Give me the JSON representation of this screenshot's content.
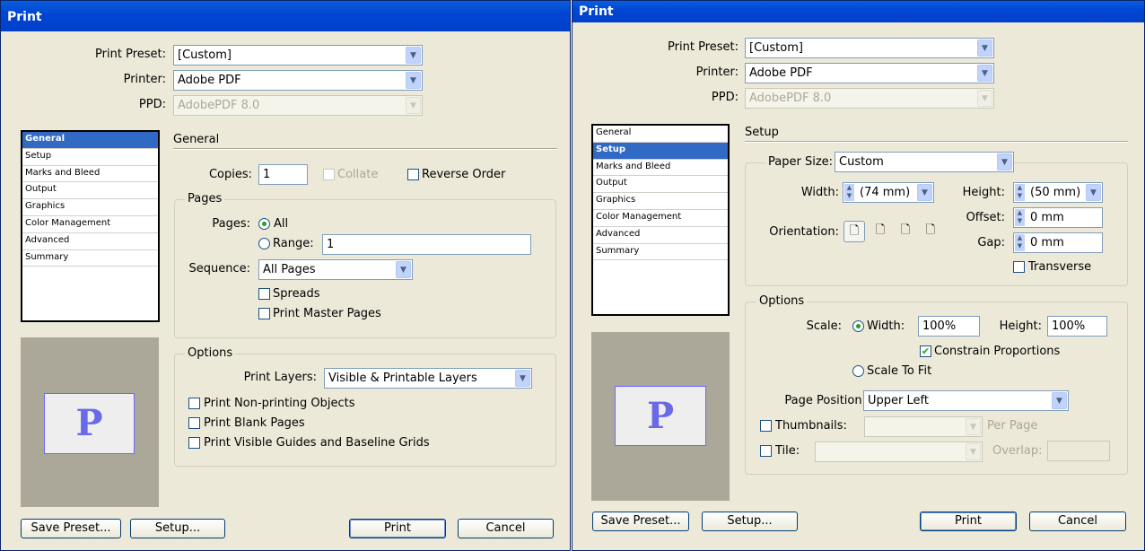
{
  "left": {
    "title": "Print",
    "print_preset_label": "Print Preset:",
    "print_preset": "[Custom]",
    "printer_label": "Printer:",
    "printer": "Adobe PDF",
    "ppd_label": "PPD:",
    "ppd": "AdobePDF 8.0",
    "nav": [
      "General",
      "Setup",
      "Marks and Bleed",
      "Output",
      "Graphics",
      "Color Management",
      "Advanced",
      "Summary"
    ],
    "selected_nav": "General",
    "preview_letter": "P",
    "heading": "General",
    "copies_label": "Copies:",
    "copies": "1",
    "collate": "Collate",
    "reverse_order": "Reverse Order",
    "pages_group": "Pages",
    "pages_label": "Pages:",
    "all": "All",
    "range": "Range:",
    "range_value": "1",
    "sequence_label": "Sequence:",
    "sequence": "All Pages",
    "spreads": "Spreads",
    "print_master_pages": "Print Master Pages",
    "options_group": "Options",
    "print_layers_label": "Print Layers:",
    "print_layers": "Visible & Printable Layers",
    "print_non_printing": "Print Non-printing Objects",
    "print_blank": "Print Blank Pages",
    "print_guides": "Print Visible Guides and Baseline Grids",
    "buttons": {
      "save_preset": "Save Preset...",
      "setup": "Setup...",
      "print": "Print",
      "cancel": "Cancel"
    }
  },
  "right": {
    "title": "Print",
    "print_preset_label": "Print Preset:",
    "print_preset": "[Custom]",
    "printer_label": "Printer:",
    "printer": "Adobe PDF",
    "ppd_label": "PPD:",
    "ppd": "AdobePDF 8.0",
    "nav": [
      "General",
      "Setup",
      "Marks and Bleed",
      "Output",
      "Graphics",
      "Color Management",
      "Advanced",
      "Summary"
    ],
    "selected_nav": "Setup",
    "preview_letter": "P",
    "heading": "Setup",
    "paper_size_label": "Paper Size:",
    "paper_size": "Custom",
    "width_label": "Width:",
    "width": "(74 mm)",
    "height_label": "Height:",
    "height": "(50 mm)",
    "offset_label": "Offset:",
    "offset": "0 mm",
    "gap_label": "Gap:",
    "gap": "0 mm",
    "orientation_label": "Orientation:",
    "transverse": "Transverse",
    "options_group": "Options",
    "scale_label": "Scale:",
    "scale_width_label": "Width:",
    "scale_width": "100%",
    "scale_height_label": "Height:",
    "scale_height": "100%",
    "constrain": "Constrain Proportions",
    "scale_to_fit": "Scale To Fit",
    "page_position_label": "Page Position:",
    "page_position": "Upper Left",
    "thumbnails": "Thumbnails:",
    "per_page": "Per Page",
    "tile": "Tile:",
    "overlap": "Overlap:",
    "buttons": {
      "save_preset": "Save Preset...",
      "setup": "Setup...",
      "print": "Print",
      "cancel": "Cancel"
    }
  }
}
